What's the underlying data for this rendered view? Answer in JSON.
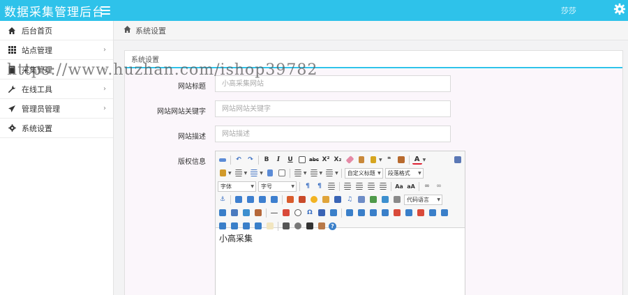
{
  "header": {
    "title": "数据采集管理后台",
    "user": "莎莎"
  },
  "sidebar": {
    "items": [
      {
        "label": "后台首页",
        "icon": "home-icon"
      },
      {
        "label": "站点管理",
        "icon": "grid-icon",
        "chevron": "›"
      },
      {
        "label": "采集管理",
        "icon": "book-icon",
        "chevron": "›"
      },
      {
        "label": "在线工具",
        "icon": "wrench-icon",
        "chevron": "›"
      },
      {
        "label": "管理员管理",
        "icon": "send-icon",
        "chevron": "›"
      },
      {
        "label": "系统设置",
        "icon": "gear-icon"
      }
    ]
  },
  "breadcrumb": {
    "label": "系统设置"
  },
  "panel": {
    "title": "系统设置"
  },
  "form": {
    "site_title": {
      "label": "网站标题",
      "placeholder": "小高采集网站"
    },
    "keywords": {
      "label": "网站网站关键字",
      "placeholder": "网站网站关键字"
    },
    "description": {
      "label": "网站描述",
      "placeholder": "网站描述"
    },
    "copyright": {
      "label": "版权信息",
      "content": "小高采集"
    }
  },
  "editor": {
    "combos": {
      "custom_title": "自定义标题",
      "paragraph": "段落格式",
      "font": "字体",
      "size": "字号",
      "code_lang": "代码语言"
    },
    "glyphs": {
      "bold": "B",
      "italic": "I",
      "underline": "U",
      "superscript": "X²",
      "subscript": "X₂",
      "quote": "❝",
      "font_color": "A",
      "anchor": "⚓",
      "omega": "Ω",
      "help": "?"
    }
  },
  "watermark": "https://www.huzhan.com/ishop39782",
  "colors": {
    "accent": "#2ec2ea",
    "form_bg": "#fbf6fb"
  }
}
